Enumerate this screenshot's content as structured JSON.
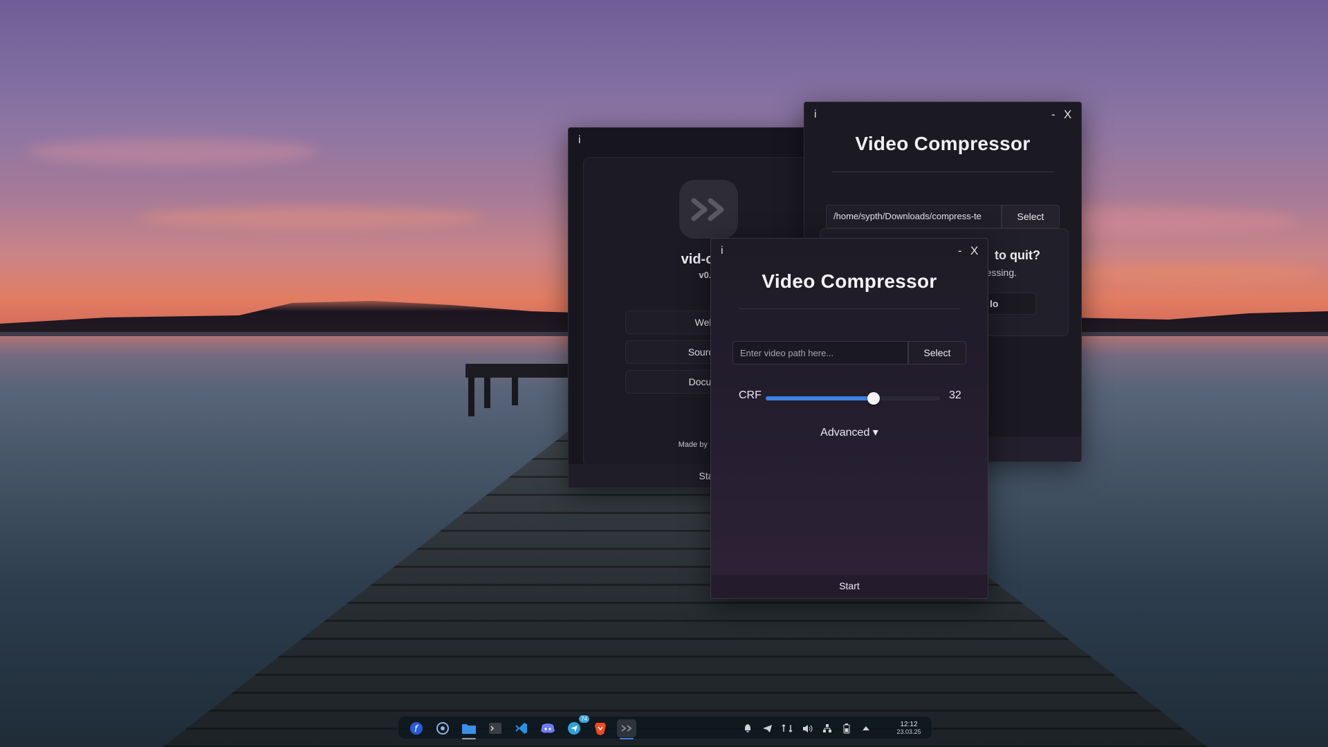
{
  "about_window": {
    "info_glyph": "i",
    "app_name": "vid-com",
    "version": "v0.1",
    "buttons": [
      "Websi",
      "Source C",
      "Documer"
    ],
    "credit": "Made by @justsy",
    "footer": "Sta"
  },
  "back_window": {
    "info_glyph": "i",
    "minimize": "-",
    "close": "X",
    "title": "Video Compressor",
    "path_value": "/home/sypth/Downloads/compress-te",
    "select_label": "Select",
    "quit_dialog": {
      "title": "to quit?",
      "subtitle": "essing.",
      "no_button": "lo"
    }
  },
  "front_window": {
    "info_glyph": "i",
    "minimize": "-",
    "close": "X",
    "title": "Video Compressor",
    "path_placeholder": "Enter video path here...",
    "select_label": "Select",
    "crf_label": "CRF",
    "crf_value": "32",
    "crf_fraction": 0.62,
    "crf_accent": "#3d82e3",
    "advanced_label": "Advanced ▾",
    "start_label": "Start"
  },
  "taskbar": {
    "apps": [
      "fedora-icon",
      "browser-icon",
      "files-icon",
      "terminal-icon",
      "vscode-icon",
      "discord-icon",
      "telegram-icon",
      "brave-icon",
      "vid-compressor-icon"
    ],
    "telegram_badge": "74",
    "tray": [
      "notification-icon",
      "telegram-tray-icon",
      "network-speed-icon",
      "volume-icon",
      "network-icon",
      "battery-icon",
      "tray-expand-icon"
    ],
    "time": "12:12",
    "date": "23.03.25"
  }
}
